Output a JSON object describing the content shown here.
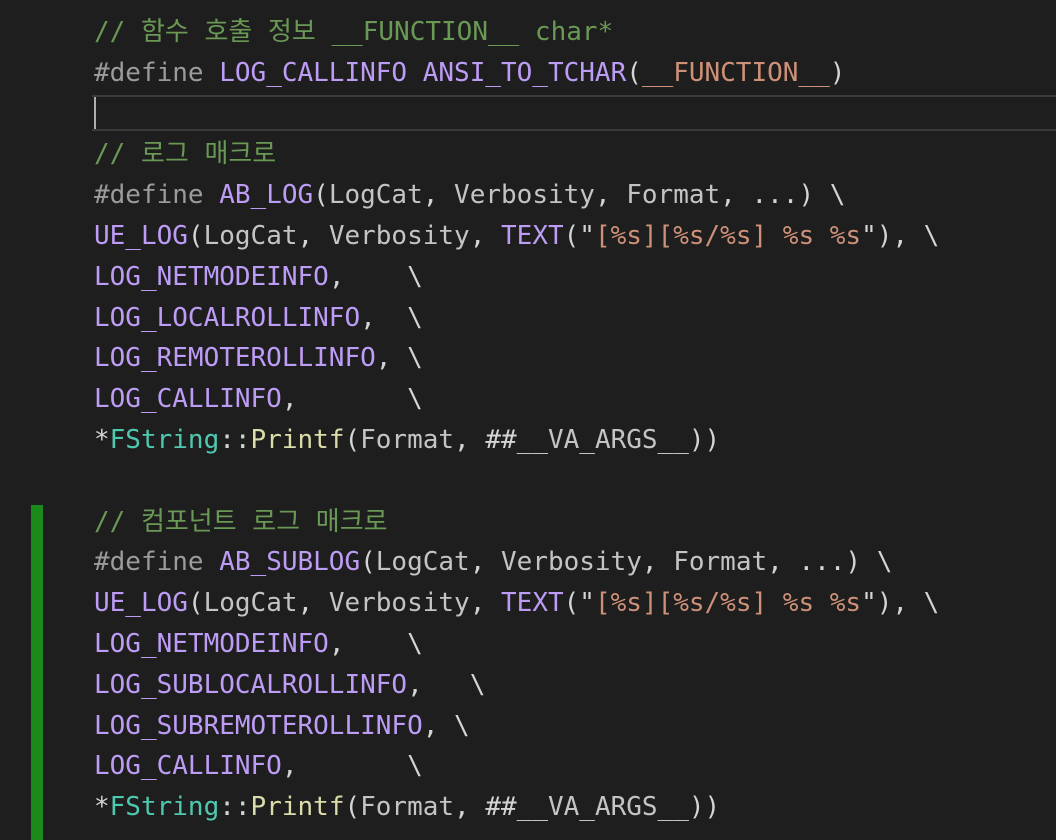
{
  "editor": {
    "lines": [
      [
        {
          "t": "// 함수 호출 정보 __FUNCTION__ char*",
          "c": "cmt"
        }
      ],
      [
        {
          "t": "#define ",
          "c": "pp"
        },
        {
          "t": "LOG_CALLINFO",
          "c": "mac"
        },
        {
          "t": " ",
          "c": "plain"
        },
        {
          "t": "ANSI_TO_TCHAR",
          "c": "mac"
        },
        {
          "t": "(",
          "c": "plain"
        },
        {
          "t": "__FUNCTION__",
          "c": "str"
        },
        {
          "t": ")",
          "c": "plain"
        }
      ],
      [],
      [
        {
          "t": "// 로그 매크로",
          "c": "cmt"
        }
      ],
      [
        {
          "t": "#define ",
          "c": "pp"
        },
        {
          "t": "AB_LOG",
          "c": "mac"
        },
        {
          "t": "(",
          "c": "plain"
        },
        {
          "t": "LogCat",
          "c": "var"
        },
        {
          "t": ", ",
          "c": "plain"
        },
        {
          "t": "Verbosity",
          "c": "var"
        },
        {
          "t": ", ",
          "c": "plain"
        },
        {
          "t": "Format",
          "c": "var"
        },
        {
          "t": ", ...) \\",
          "c": "plain"
        }
      ],
      [
        {
          "t": "UE_LOG",
          "c": "mac"
        },
        {
          "t": "(",
          "c": "plain"
        },
        {
          "t": "LogCat",
          "c": "var"
        },
        {
          "t": ", ",
          "c": "plain"
        },
        {
          "t": "Verbosity",
          "c": "var"
        },
        {
          "t": ", ",
          "c": "plain"
        },
        {
          "t": "TEXT",
          "c": "mac"
        },
        {
          "t": "(\"",
          "c": "plain"
        },
        {
          "t": "[%s][%s/%s] %s %s",
          "c": "str"
        },
        {
          "t": "\"), \\",
          "c": "plain"
        }
      ],
      [
        {
          "t": "LOG_NETMODEINFO",
          "c": "mac"
        },
        {
          "t": ",    \\",
          "c": "plain"
        }
      ],
      [
        {
          "t": "LOG_LOCALROLLINFO",
          "c": "mac"
        },
        {
          "t": ",  \\",
          "c": "plain"
        }
      ],
      [
        {
          "t": "LOG_REMOTEROLLINFO",
          "c": "mac"
        },
        {
          "t": ", \\",
          "c": "plain"
        }
      ],
      [
        {
          "t": "LOG_CALLINFO",
          "c": "mac"
        },
        {
          "t": ",       \\",
          "c": "plain"
        }
      ],
      [
        {
          "t": "*",
          "c": "plain"
        },
        {
          "t": "FString",
          "c": "typ"
        },
        {
          "t": "::",
          "c": "plain"
        },
        {
          "t": "Printf",
          "c": "fn"
        },
        {
          "t": "(",
          "c": "plain"
        },
        {
          "t": "Format",
          "c": "var"
        },
        {
          "t": ", ##",
          "c": "plain"
        },
        {
          "t": "__VA_ARGS__",
          "c": "var"
        },
        {
          "t": "))",
          "c": "plain"
        }
      ],
      [],
      [
        {
          "t": "// 컴포넌트 로그 매크로",
          "c": "cmt"
        }
      ],
      [
        {
          "t": "#define ",
          "c": "pp"
        },
        {
          "t": "AB_SUBLOG",
          "c": "mac"
        },
        {
          "t": "(",
          "c": "plain"
        },
        {
          "t": "LogCat",
          "c": "var"
        },
        {
          "t": ", ",
          "c": "plain"
        },
        {
          "t": "Verbosity",
          "c": "var"
        },
        {
          "t": ", ",
          "c": "plain"
        },
        {
          "t": "Format",
          "c": "var"
        },
        {
          "t": ", ...) \\",
          "c": "plain"
        }
      ],
      [
        {
          "t": "UE_LOG",
          "c": "mac"
        },
        {
          "t": "(",
          "c": "plain"
        },
        {
          "t": "LogCat",
          "c": "var"
        },
        {
          "t": ", ",
          "c": "plain"
        },
        {
          "t": "Verbosity",
          "c": "var"
        },
        {
          "t": ", ",
          "c": "plain"
        },
        {
          "t": "TEXT",
          "c": "mac"
        },
        {
          "t": "(\"",
          "c": "plain"
        },
        {
          "t": "[%s][%s/%s] %s %s",
          "c": "str"
        },
        {
          "t": "\"), \\",
          "c": "plain"
        }
      ],
      [
        {
          "t": "LOG_NETMODEINFO",
          "c": "mac"
        },
        {
          "t": ",    \\",
          "c": "plain"
        }
      ],
      [
        {
          "t": "LOG_SUBLOCALROLLINFO",
          "c": "mac"
        },
        {
          "t": ",   \\",
          "c": "plain"
        }
      ],
      [
        {
          "t": "LOG_SUBREMOTEROLLINFO",
          "c": "mac"
        },
        {
          "t": ", \\",
          "c": "plain"
        }
      ],
      [
        {
          "t": "LOG_CALLINFO",
          "c": "mac"
        },
        {
          "t": ",       \\",
          "c": "plain"
        }
      ],
      [
        {
          "t": "*",
          "c": "plain"
        },
        {
          "t": "FString",
          "c": "typ"
        },
        {
          "t": "::",
          "c": "plain"
        },
        {
          "t": "Printf",
          "c": "fn"
        },
        {
          "t": "(",
          "c": "plain"
        },
        {
          "t": "Format",
          "c": "var"
        },
        {
          "t": ", ##",
          "c": "plain"
        },
        {
          "t": "__VA_ARGS__",
          "c": "var"
        },
        {
          "t": "))",
          "c": "plain"
        }
      ]
    ]
  },
  "colors": {
    "background": "#1e1e1e",
    "comment": "#6a9955",
    "preprocessor": "#9b9b9b",
    "macro": "#bd9cf5",
    "string": "#ce9178",
    "type": "#4ec9b0",
    "function": "#dcdcaa",
    "modified_gutter": "#1a8a1a"
  }
}
